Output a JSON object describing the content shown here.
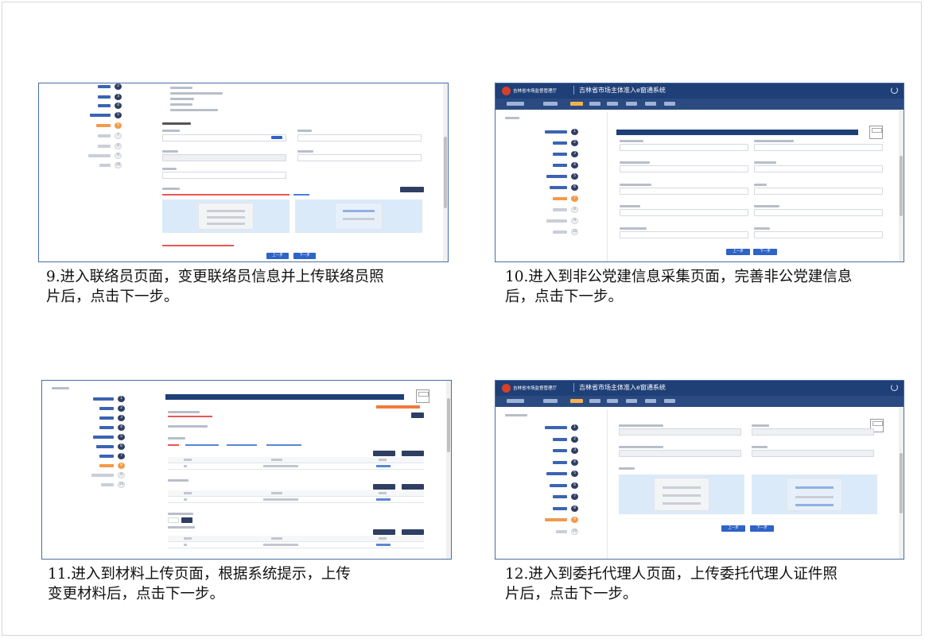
{
  "captions": {
    "step9": "9.进入联络员页面，变更联络员信息并上传联络员照\n片后，点击下一步。",
    "step10": "10.进入到非公党建信息采集页面，完善非公党建信息\n后，点击下一步。",
    "step11": "11.进入到材料上传页面，根据系统提示，上传\n变更材料后，点击下一步。",
    "step12": "12.进入到委托代理人页面，上传委托代理人证件照\n片后，点击下一步。"
  },
  "app": {
    "org_name": "吉林省市场监督管理厅",
    "system_name": "吉林省市场主体准入e窗通系统"
  },
  "buttons": {
    "prev": "上一步",
    "next": "下一步"
  },
  "colors": {
    "header": "#1f3f77",
    "accent": "#2e63c7",
    "current_step": "#f29a4c"
  }
}
